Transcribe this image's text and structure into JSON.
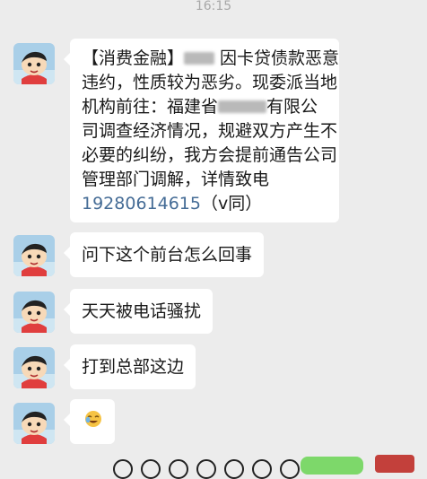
{
  "status": {
    "time": "16:15"
  },
  "messages": [
    {
      "lines": [
        {
          "segments": [
            {
              "type": "text",
              "text": "【消费金融】"
            },
            {
              "type": "redact",
              "size": 3
            },
            {
              "type": "text",
              "text": "  因卡贷债款恶意"
            }
          ]
        },
        {
          "segments": [
            {
              "type": "text",
              "text": "违约，性质较为恶劣。现委派当地"
            }
          ]
        },
        {
          "segments": [
            {
              "type": "text",
              "text": "机构前往：福建省"
            },
            {
              "type": "redact",
              "size": 5
            },
            {
              "type": "text",
              "text": "有限公"
            }
          ]
        },
        {
          "segments": [
            {
              "type": "text",
              "text": "司调查经济情况，规避双方产生不"
            }
          ]
        },
        {
          "segments": [
            {
              "type": "text",
              "text": "必要的纠纷，我方会提前通告公司"
            }
          ]
        },
        {
          "segments": [
            {
              "type": "text",
              "text": "管理部门调解，详情致电"
            }
          ]
        },
        {
          "segments": [
            {
              "type": "phone",
              "text": "19280614615"
            },
            {
              "type": "text",
              "text": "（v同）"
            }
          ]
        }
      ]
    },
    {
      "text": "问下这个前台怎么回事"
    },
    {
      "text": "天天被电话骚扰"
    },
    {
      "text": "打到总部这边"
    },
    {
      "emoji": "face-emoji"
    }
  ],
  "colors": {
    "background": "#ececec",
    "bubble": "#ffffff",
    "link": "#456c96",
    "timestamp": "#a8a8a8"
  },
  "icons": {
    "avatar": "cartoon-boy-avatar-icon",
    "bottom_green": "green-button",
    "bottom_red": "red-badge"
  }
}
